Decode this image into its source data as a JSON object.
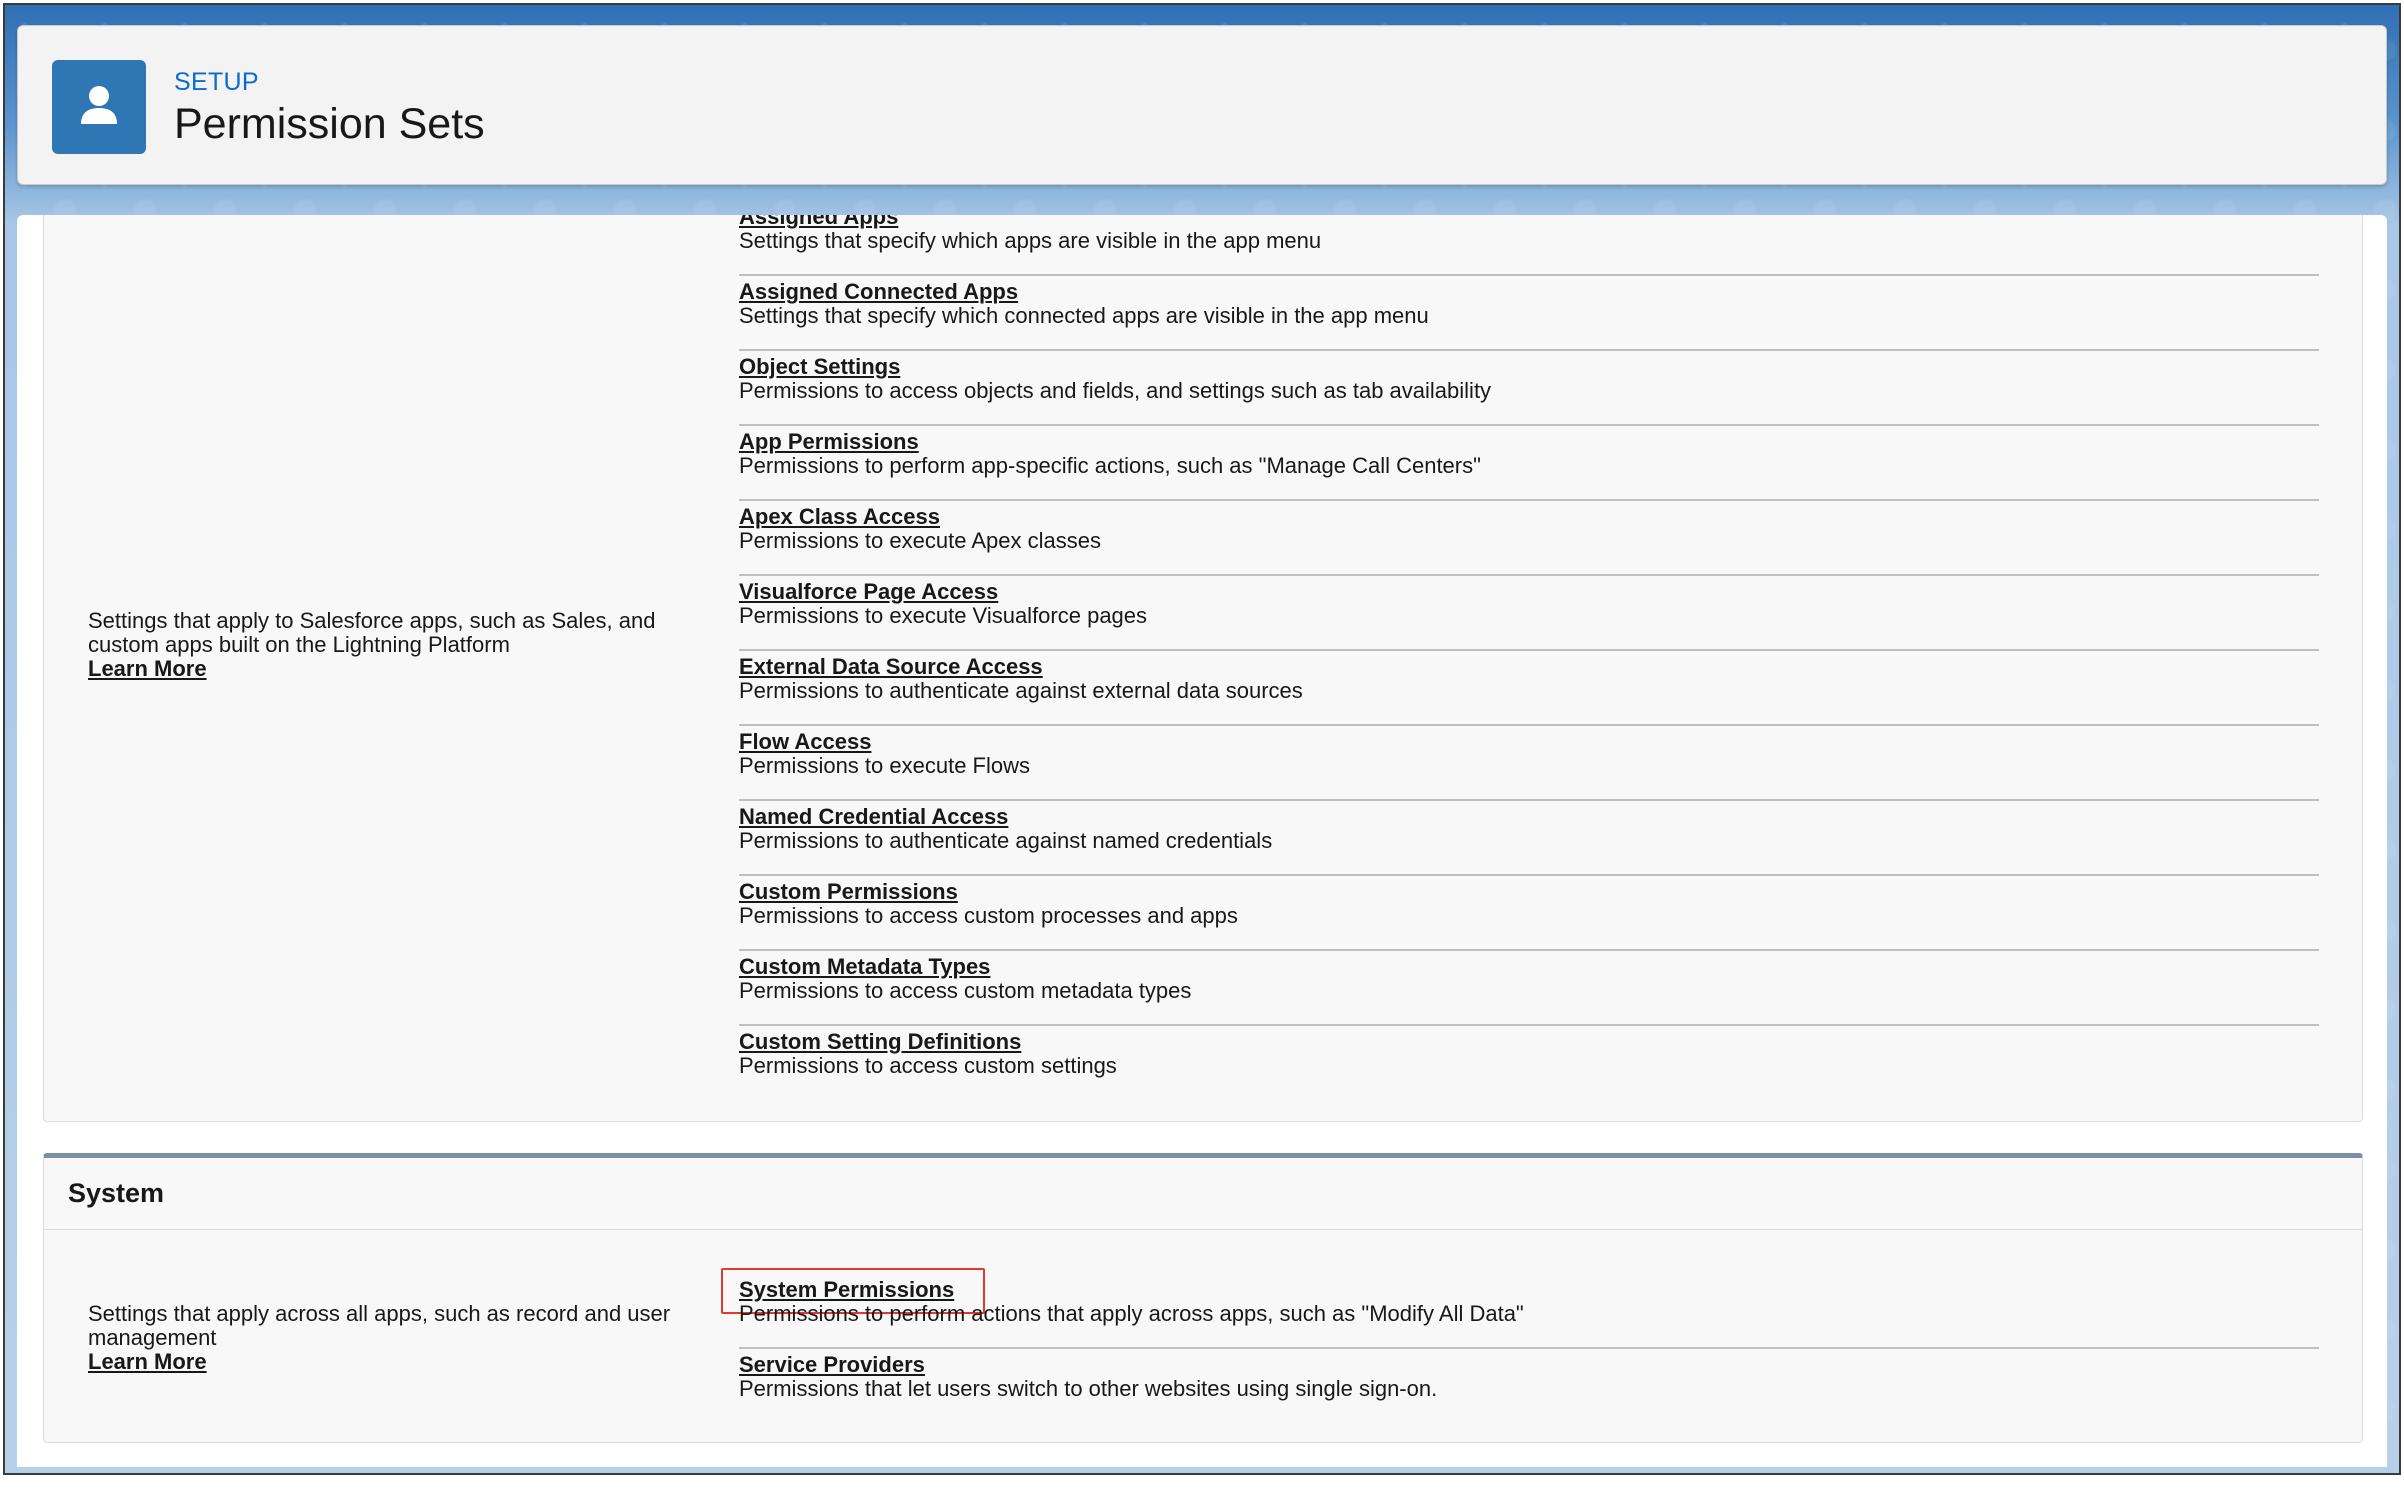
{
  "header": {
    "eyebrow": "SETUP",
    "title": "Permission Sets",
    "icon": "user-icon"
  },
  "apps_section": {
    "description": "Settings that apply to Salesforce apps, such as Sales, and custom apps built on the Lightning Platform",
    "learn_more": "Learn More",
    "items": [
      {
        "label": "Assigned Apps",
        "desc": "Settings that specify which apps are visible in the app menu"
      },
      {
        "label": "Assigned Connected Apps",
        "desc": "Settings that specify which connected apps are visible in the app menu"
      },
      {
        "label": "Object Settings",
        "desc": "Permissions to access objects and fields, and settings such as tab availability"
      },
      {
        "label": "App Permissions",
        "desc": "Permissions to perform app-specific actions, such as \"Manage Call Centers\""
      },
      {
        "label": "Apex Class Access",
        "desc": "Permissions to execute Apex classes"
      },
      {
        "label": "Visualforce Page Access",
        "desc": "Permissions to execute Visualforce pages"
      },
      {
        "label": "External Data Source Access",
        "desc": "Permissions to authenticate against external data sources"
      },
      {
        "label": "Flow Access",
        "desc": "Permissions to execute Flows"
      },
      {
        "label": "Named Credential Access",
        "desc": "Permissions to authenticate against named credentials"
      },
      {
        "label": "Custom Permissions",
        "desc": "Permissions to access custom processes and apps"
      },
      {
        "label": "Custom Metadata Types",
        "desc": "Permissions to access custom metadata types"
      },
      {
        "label": "Custom Setting Definitions",
        "desc": "Permissions to access custom settings"
      }
    ]
  },
  "system_section": {
    "title": "System",
    "description": "Settings that apply across all apps, such as record and user management",
    "learn_more": "Learn More",
    "items": [
      {
        "label": "System Permissions",
        "desc": "Permissions to perform actions that apply across apps, such as \"Modify All Data\""
      },
      {
        "label": "Service Providers",
        "desc": "Permissions that let users switch to other websites using single sign-on."
      }
    ]
  },
  "colors": {
    "brand_icon": "#2f77b4",
    "setup_link": "#0b6bd0",
    "highlight_box": "#e0392f"
  }
}
